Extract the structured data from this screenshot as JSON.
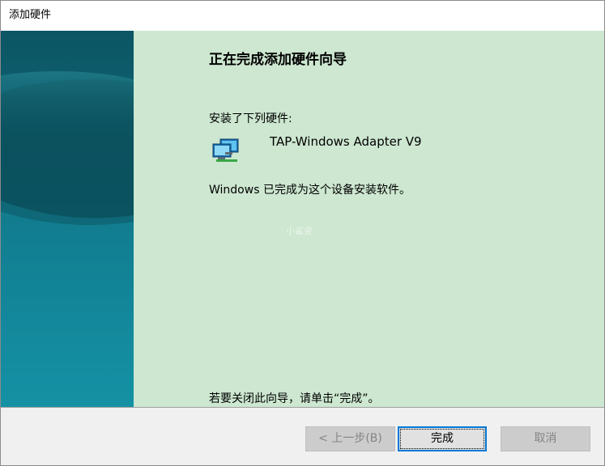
{
  "window": {
    "title": "添加硬件"
  },
  "wizard": {
    "heading": "正在完成添加硬件向导",
    "installed_label": "安装了下列硬件:",
    "device": {
      "icon": "network-adapter-icon",
      "name": "TAP-Windows Adapter V9"
    },
    "done_message": "Windows 已完成为这个设备安装软件。",
    "watermark": "小鲨瓷",
    "close_hint": "若要关闭此向导，请单击“完成”。"
  },
  "buttons": {
    "back_label": "< 上一步(B)",
    "back_enabled": false,
    "finish_label": "完成",
    "finish_focused": true,
    "cancel_label": "取消",
    "cancel_enabled": false
  },
  "colors": {
    "side_panel": "#0f6878",
    "content_bg": "#cde7d0",
    "focus_border": "#0078d7",
    "disabled_text": "#858585"
  }
}
